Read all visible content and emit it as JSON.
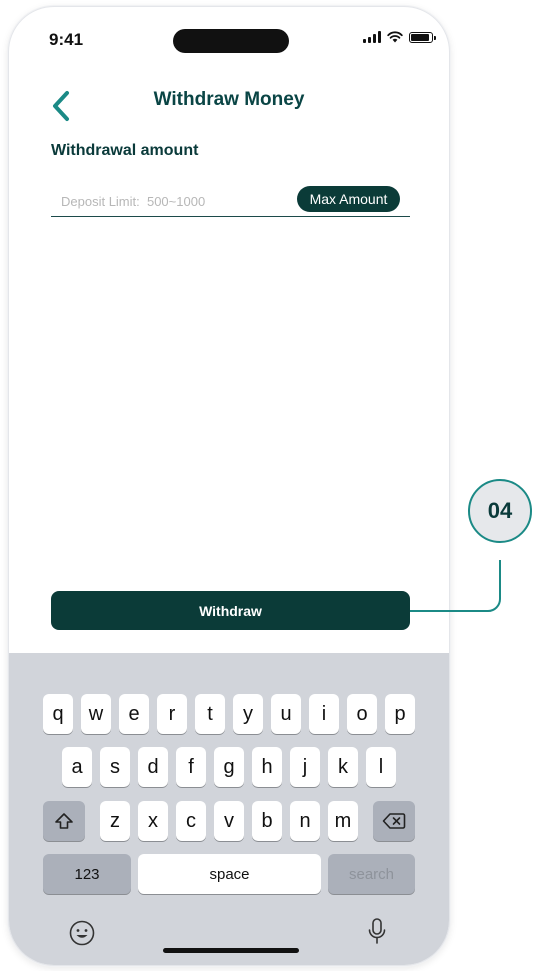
{
  "status_bar": {
    "time": "9:41"
  },
  "header": {
    "title": "Withdraw Money"
  },
  "form": {
    "label": "Withdrawal amount",
    "placeholder": "Deposit Limit:  500~1000",
    "max_button": "Max Amount"
  },
  "withdraw_button": "Withdraw",
  "annotation": "04",
  "keyboard": {
    "row1": [
      "q",
      "w",
      "e",
      "r",
      "t",
      "y",
      "u",
      "i",
      "o",
      "p"
    ],
    "row2": [
      "a",
      "s",
      "d",
      "f",
      "g",
      "h",
      "j",
      "k",
      "l"
    ],
    "row3": [
      "z",
      "x",
      "c",
      "v",
      "b",
      "n",
      "m"
    ],
    "numbers_key": "123",
    "space_key": "space",
    "search_key": "search"
  },
  "colors": {
    "brand": "#0b3b38",
    "accent": "#1b8a86",
    "keyboard_bg": "#d1d4da"
  }
}
